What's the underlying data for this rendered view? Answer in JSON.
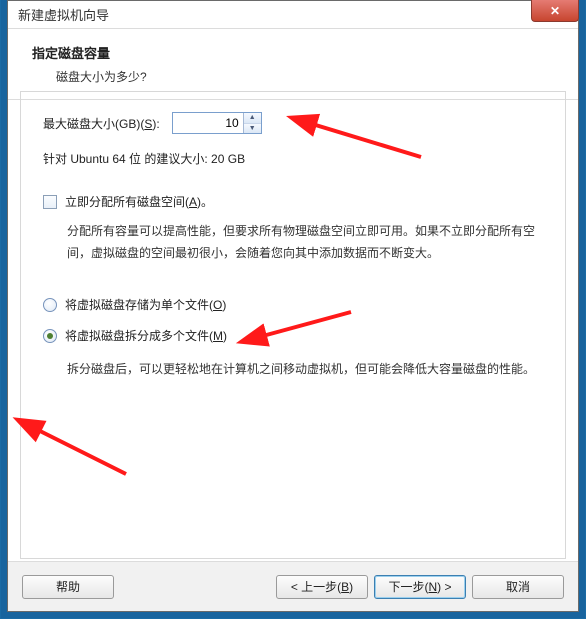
{
  "window": {
    "title": "新建虚拟机向导",
    "close_glyph": "✕"
  },
  "header": {
    "title": "指定磁盘容量",
    "subtitle": "磁盘大小为多少?"
  },
  "disk_size": {
    "label_pre": "最大磁盘大小(GB)(",
    "label_key": "S",
    "label_post": "):",
    "value": "10",
    "rec_text": "针对 Ubuntu 64 位 的建议大小: 20 GB"
  },
  "allocate": {
    "label_pre": "立即分配所有磁盘空间(",
    "label_key": "A",
    "label_post": ")。",
    "desc": "分配所有容量可以提高性能，但要求所有物理磁盘空间立即可用。如果不立即分配所有空间，虚拟磁盘的空间最初很小，会随着您向其中添加数据而不断变大。"
  },
  "radios": {
    "single_pre": "将虚拟磁盘存储为单个文件(",
    "single_key": "O",
    "single_post": ")",
    "split_pre": "将虚拟磁盘拆分成多个文件(",
    "split_key": "M",
    "split_post": ")",
    "split_desc": "拆分磁盘后，可以更轻松地在计算机之间移动虚拟机，但可能会降低大容量磁盘的性能。"
  },
  "footer": {
    "help": "帮助",
    "back_pre": "< 上一步(",
    "back_key": "B",
    "back_post": ")",
    "next_pre": "下一步(",
    "next_key": "N",
    "next_post": ") >",
    "cancel": "取消"
  }
}
